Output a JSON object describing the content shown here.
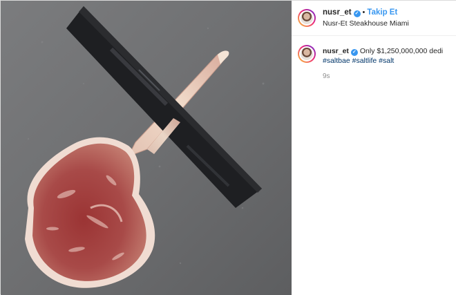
{
  "header": {
    "username": "nusr_et",
    "separator": "•",
    "follow_label": "Takip Et",
    "location": "Nusr-Et Steakhouse Miami"
  },
  "caption": {
    "username": "nusr_et",
    "text": "Only $1,250,000,000 dedi",
    "hashtags": [
      "#saltbae",
      "#saltlife",
      "#salt"
    ],
    "timestamp": "9s"
  },
  "icons": {
    "verified": "verified-badge-icon",
    "avatar": "profile-avatar"
  },
  "colors": {
    "link_blue": "#3897f0",
    "hashtag_blue": "#003569",
    "verified_blue": "#3897f0",
    "muted_gray": "#8e8e8e"
  }
}
